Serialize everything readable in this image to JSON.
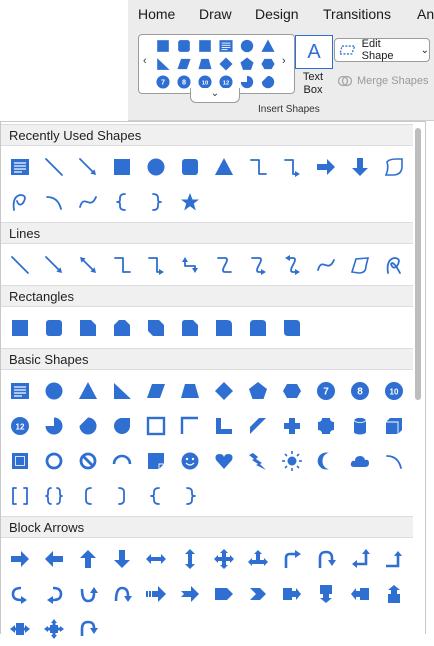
{
  "ribbon": {
    "tabs": [
      "Home",
      "Draw",
      "Design",
      "Transitions",
      "An"
    ],
    "gallery": {
      "prev_arrow": "‹",
      "next_arrow": "›",
      "expand": "⌄",
      "icons": [
        "rectangle",
        "rounded-rectangle",
        "snip-rectangle",
        "text-box",
        "circle",
        "triangle",
        "right-triangle",
        "parallelogram",
        "trapezoid",
        "diamond",
        "pentagon",
        "hexagon",
        "badge-7",
        "badge-8",
        "badge-10",
        "badge-12",
        "pie",
        "chord"
      ]
    },
    "text_box": {
      "glyph": "A",
      "label": "Text Box"
    },
    "edit_shape": {
      "label": "Edit Shape",
      "caret": "⌄"
    },
    "merge_shapes": {
      "label": "Merge Shapes"
    },
    "group_label": "Insert Shapes"
  },
  "panel": {
    "sections": [
      {
        "title": "Recently Used Shapes",
        "rows": [
          [
            "text-box",
            "line",
            "line-arrow",
            "rectangle",
            "circle",
            "rounded-rectangle",
            "triangle",
            "elbow-connector",
            "elbow-arrow-connector",
            "right-arrow",
            "down-arrow",
            "snip-shape"
          ],
          [
            "freeform-loop",
            "arc",
            "curve",
            "left-brace",
            "right-brace",
            "star"
          ]
        ]
      },
      {
        "title": "Lines",
        "rows": [
          [
            "line",
            "line-arrow",
            "line-double-arrow",
            "elbow-connector",
            "elbow-arrow-connector",
            "elbow-double-arrow",
            "curved-connector",
            "curved-arrow-connector",
            "curved-double-arrow",
            "curve",
            "freeform",
            "scribble"
          ]
        ]
      },
      {
        "title": "Rectangles",
        "rows": [
          [
            "rectangle",
            "rounded-rectangle",
            "snip-single-corner",
            "snip-same-side",
            "snip-diagonal",
            "snip-round",
            "round-single-corner",
            "round-same-side",
            "round-diagonal"
          ]
        ]
      },
      {
        "title": "Basic Shapes",
        "rows": [
          [
            "text-box",
            "oval",
            "triangle",
            "right-triangle",
            "parallelogram",
            "trapezoid",
            "diamond",
            "pentagon",
            "hexagon",
            "badge-7",
            "badge-8",
            "badge-10"
          ],
          [
            "badge-12",
            "pie",
            "chord",
            "teardrop",
            "frame",
            "half-frame",
            "l-shape",
            "diagonal-stripe",
            "cross",
            "plaque",
            "can",
            "cube"
          ],
          [
            "bevel",
            "donut",
            "no-symbol",
            "block-arc",
            "folded-corner",
            "smiley",
            "heart",
            "lightning",
            "sun",
            "moon",
            "cloud",
            "arc"
          ],
          [
            "double-bracket",
            "double-brace",
            "left-bracket",
            "right-bracket",
            "left-brace",
            "right-brace"
          ]
        ]
      },
      {
        "title": "Block Arrows",
        "rows": [
          [
            "right-arrow",
            "left-arrow",
            "up-arrow",
            "down-arrow",
            "left-right-arrow",
            "up-down-arrow",
            "quad-arrow",
            "left-right-up-arrow",
            "bent-arrow",
            "u-turn-arrow",
            "left-up-arrow",
            "bent-up-arrow"
          ],
          [
            "curved-right-arrow",
            "curved-left-arrow",
            "curved-up-arrow",
            "curved-down-arrow",
            "striped-right-arrow",
            "notched-right-arrow",
            "pentagon-arrow",
            "chevron",
            "right-arrow-callout",
            "down-arrow-callout",
            "left-arrow-callout",
            "up-arrow-callout"
          ],
          [
            "left-right-arrow-callout",
            "quad-arrow-callout",
            "circular-arrow"
          ]
        ]
      }
    ]
  },
  "colors": {
    "shape_blue": "#2f6fd1",
    "header_bg": "#f0f0f0",
    "ribbon_bg": "#ececec"
  }
}
